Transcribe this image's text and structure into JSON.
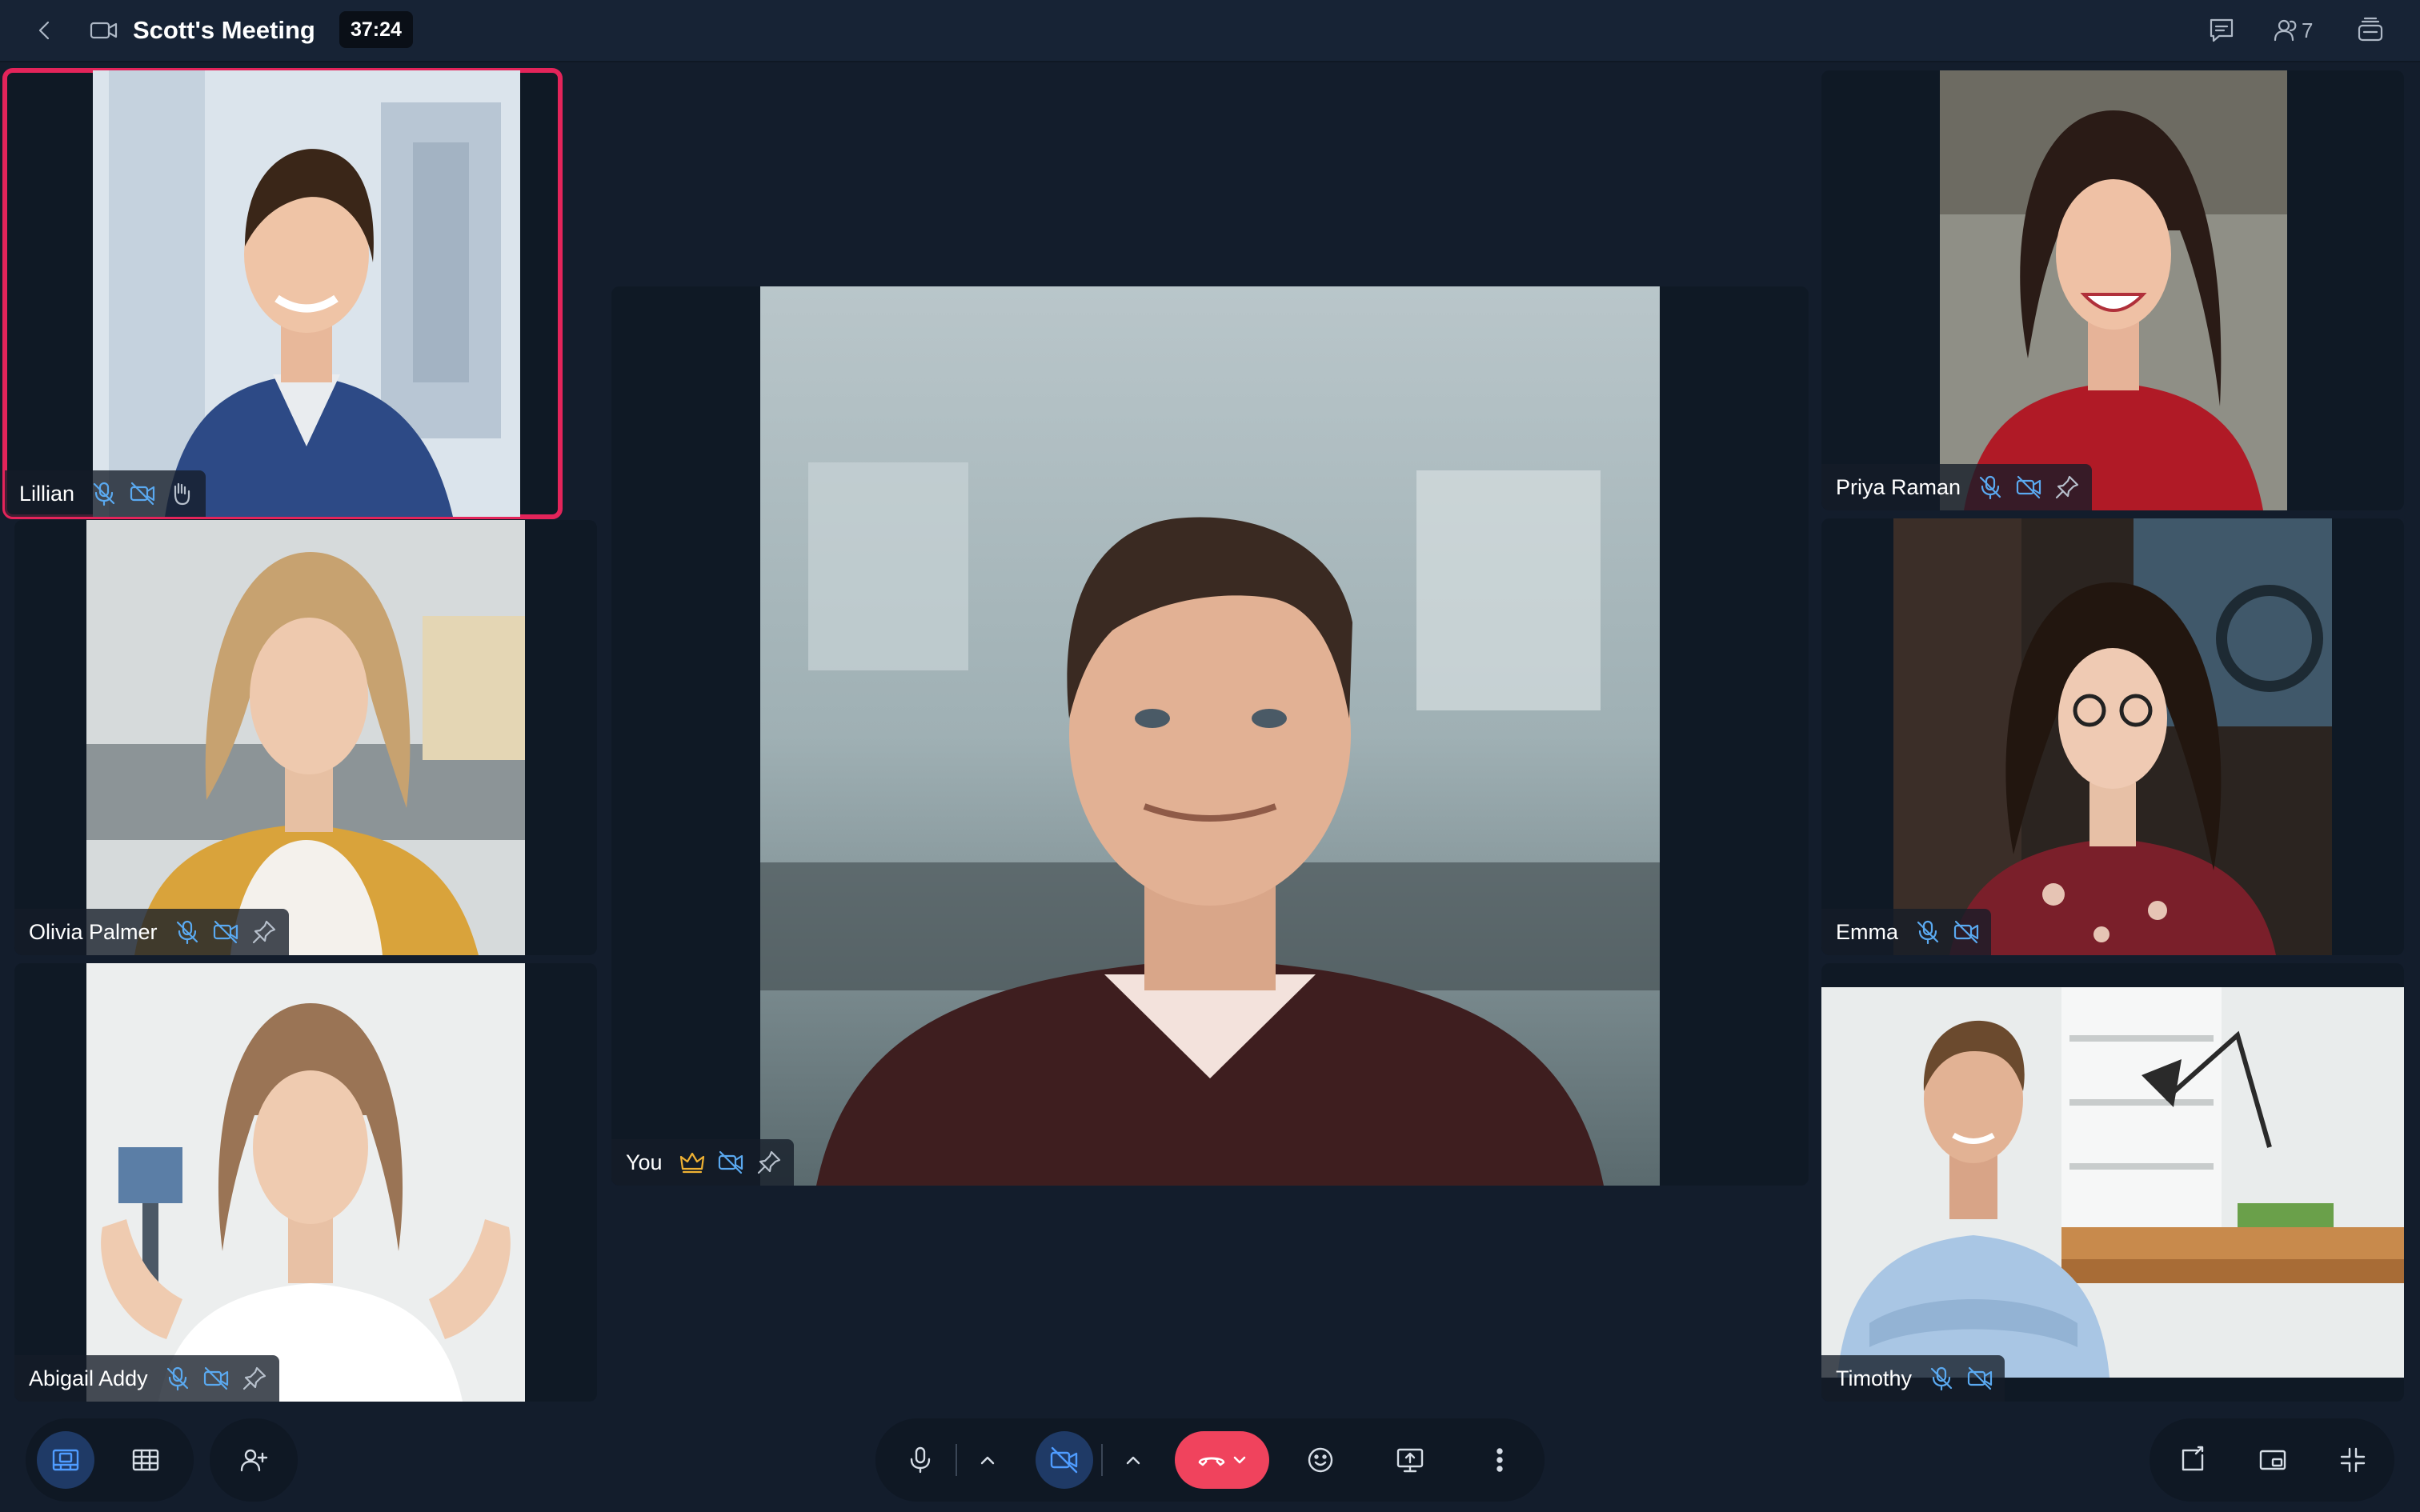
{
  "meeting": {
    "title": "Scott's Meeting",
    "timer": "37:24",
    "participant_count": "7"
  },
  "tiles": [
    {
      "name": "Lillian",
      "mic": "muted",
      "video": "off",
      "extra": "raised-hand-icon",
      "active": true
    },
    {
      "name": "Olivia Palmer",
      "mic": "muted",
      "video": "off",
      "extra": "pin-icon"
    },
    {
      "name": "Abigail Addy",
      "mic": "muted",
      "video": "off",
      "extra": "pin-icon"
    },
    {
      "name": "You",
      "role": "host",
      "crown": "crown-icon",
      "video": "off",
      "extra": "pin-icon"
    },
    {
      "name": "Priya Raman",
      "mic": "muted",
      "video": "off",
      "extra": "pin-icon"
    },
    {
      "name": "Emma",
      "mic": "muted",
      "video": "off"
    },
    {
      "name": "Timothy",
      "mic": "muted",
      "video": "off"
    }
  ],
  "controls": {
    "left": [
      "speaker-view-icon",
      "grid-view-icon",
      "add-participant-icon"
    ],
    "center": [
      "microphone-icon",
      "mic-options-chevron-icon",
      "video-off-icon",
      "video-options-chevron-icon",
      "end-call-icon",
      "reactions-icon",
      "share-screen-icon",
      "more-options-icon"
    ],
    "right": [
      "pop-out-icon",
      "picture-in-picture-icon",
      "minimize-icon"
    ]
  },
  "colors": {
    "background": "#131d2c",
    "active_speaker_border": "#e3245a",
    "end_call": "#f0435d",
    "selected_control": "#4f9cff",
    "muted_icon": "#5aa9f0",
    "host_crown": "#f0b233"
  }
}
